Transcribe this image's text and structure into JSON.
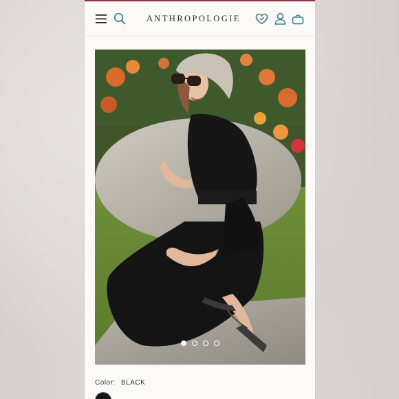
{
  "header": {
    "logo_text": "ANTHROPOLOGIE",
    "menu_icon": "hamburger-icon",
    "search_icon": "search-icon",
    "wishlist_icon": "heart-icon",
    "account_icon": "user-icon",
    "bag_icon": "shopping-bag-icon",
    "accent_color": "#3a7d8c"
  },
  "gallery": {
    "slide_count": 4,
    "active_slide": 1
  },
  "product": {
    "color_label": "Color:",
    "color_value": "BLACK"
  }
}
